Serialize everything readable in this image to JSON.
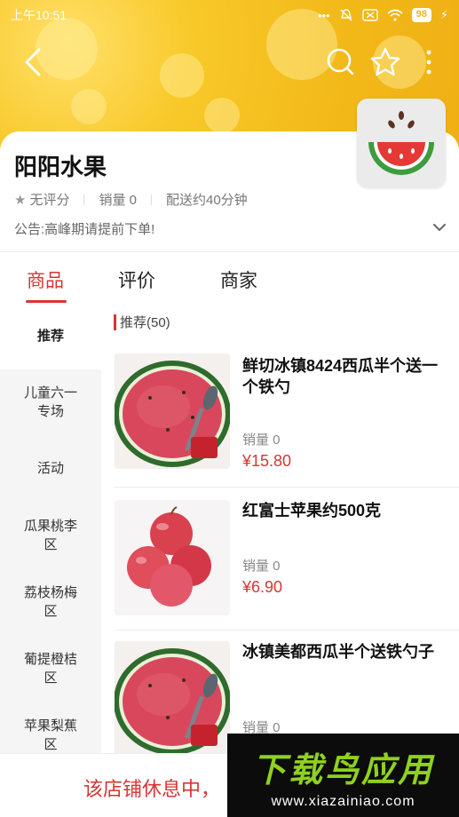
{
  "status_bar": {
    "time": "上午10:51",
    "battery": "98"
  },
  "nav": {
    "back_icon": "chevron-left-icon",
    "search_icon": "search-icon",
    "favorite_icon": "star-outline-icon",
    "more_icon": "more-vertical-icon"
  },
  "store": {
    "name": "阳阳水果",
    "rating": "无评分",
    "sales": "销量 0",
    "delivery": "配送约40分钟",
    "notice": "公告:高峰期请提前下单!",
    "logo_icon": "watermelon-icon"
  },
  "tabs": [
    {
      "label": "商品",
      "active": true
    },
    {
      "label": "评价",
      "active": false
    },
    {
      "label": "商家",
      "active": false
    }
  ],
  "categories": [
    {
      "label": "推荐",
      "active": true
    },
    {
      "label": "儿童六一专场",
      "active": false
    },
    {
      "label": "活动",
      "active": false
    },
    {
      "label": "瓜果桃李区",
      "active": false
    },
    {
      "label": "荔枝杨梅区",
      "active": false
    },
    {
      "label": "葡提橙桔区",
      "active": false
    },
    {
      "label": "苹果梨蕉区",
      "active": false
    }
  ],
  "section": {
    "title": "推荐(50)"
  },
  "products": [
    {
      "name": "鲜切冰镇8424西瓜半个送一个铁勺",
      "sales": "销量 0",
      "price": "¥15.80",
      "image": "watermelon-half"
    },
    {
      "name": "红富士苹果约500克",
      "sales": "销量 0",
      "price": "¥6.90",
      "image": "apples"
    },
    {
      "name": "冰镇美都西瓜半个送铁勺子",
      "sales": "销量 0",
      "price": "",
      "image": "watermelon-half"
    }
  ],
  "bottom": {
    "closed_text": "该店铺休息中，"
  },
  "watermark": {
    "title": "下载鸟应用",
    "url": "www.xiazainiao.com"
  },
  "colors": {
    "accent": "#d73535",
    "header": "#f2b818",
    "watermark_green": "#8fd11f"
  }
}
